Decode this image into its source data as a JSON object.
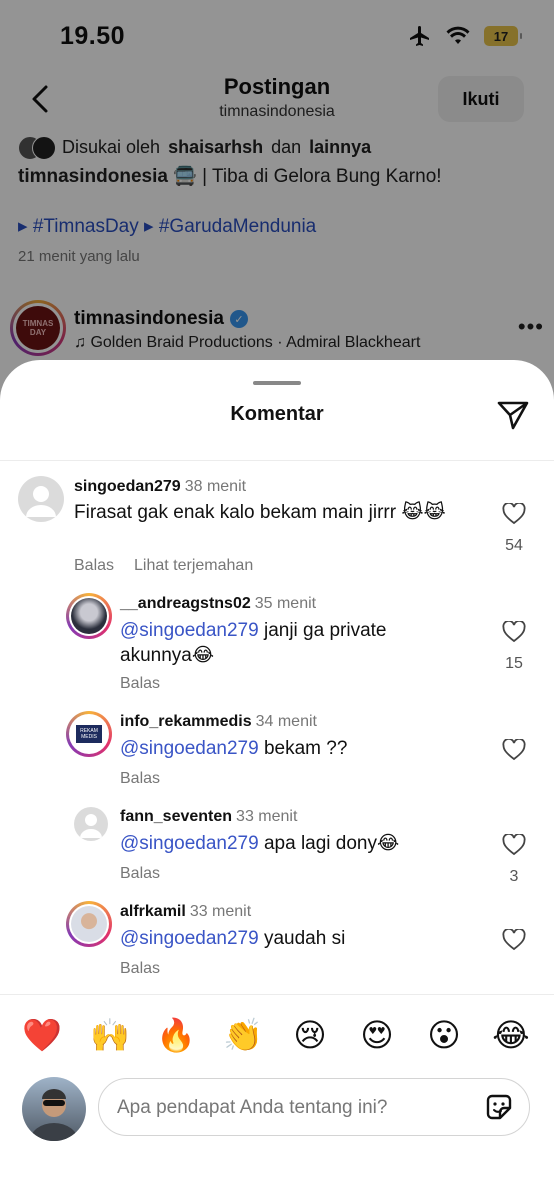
{
  "status_bar": {
    "time": "19.50",
    "battery": "17"
  },
  "nav": {
    "title": "Postingan",
    "subtitle": "timnasindonesia",
    "follow_label": "Ikuti"
  },
  "post": {
    "liked_by_prefix": "Disukai oleh",
    "liked_by_user": "shaisarhsh",
    "liked_by_mid": "dan",
    "liked_by_rest": "lainnya",
    "caption_user": "timnasindonesia",
    "caption_text": "🚍 | Tiba di Gelora Bung Karno!",
    "hashtag_1": "▸ #TimnasDay",
    "hashtag_2": "▸ #GarudaMendunia",
    "time_ago": "21 menit yang lalu"
  },
  "next_post": {
    "avatar_text": "TIMNAS DAY",
    "username": "timnasindonesia",
    "music": "Golden Braid Productions · Admiral Blackheart",
    "more": "•••"
  },
  "sheet": {
    "title": "Komentar"
  },
  "comments": [
    {
      "username": "singoedan279",
      "time": "38 menit",
      "text": "Firasat gak enak kalo bekam main jirrr 😹😹",
      "reply_label": "Balas",
      "translate_label": "Lihat terjemahan",
      "likes": "54"
    },
    {
      "username": "__andreagstns02",
      "time": "35 menit",
      "mention": "@singoedan279",
      "text": "janji ga private akunnya😂",
      "reply_label": "Balas",
      "likes": "15"
    },
    {
      "username": "info_rekammedis",
      "time": "34 menit",
      "avatar_text": "REKAM MEDIS",
      "mention": "@singoedan279",
      "text": "bekam ??",
      "reply_label": "Balas",
      "likes": ""
    },
    {
      "username": "fann_seventen",
      "time": "33 menit",
      "mention": "@singoedan279",
      "text": "apa lagi dony😂",
      "reply_label": "Balas",
      "likes": "3"
    },
    {
      "username": "alfrkamil",
      "time": "33 menit",
      "mention": "@singoedan279",
      "text": "yaudah si",
      "reply_label": "Balas",
      "likes": ""
    }
  ],
  "emoji_bar": [
    "❤️",
    "🙌",
    "🔥",
    "👏",
    "😢",
    "😍",
    "😮",
    "😂"
  ],
  "input": {
    "placeholder": "Apa pendapat Anda tentang ini?"
  },
  "icons": {
    "back": "chevron-left-icon",
    "share": "paper-plane-icon",
    "heart": "heart-outline-icon",
    "sticker": "sticker-icon",
    "music": "music-note-icon",
    "verified": "verified-badge-icon"
  },
  "colors": {
    "mention": "#3a55c6",
    "hashtag": "#2a4fbf",
    "verified": "#3897f0",
    "battery": "#e7c34a"
  }
}
